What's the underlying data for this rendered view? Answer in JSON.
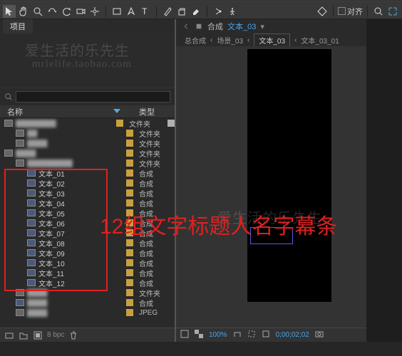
{
  "toolbar": {
    "align_label": "对齐"
  },
  "panel": {
    "project_tab": "项目"
  },
  "columns": {
    "name": "名称",
    "type_header": "类型"
  },
  "types": {
    "folder": "文件夹",
    "comp": "合成",
    "jpeg": "JPEG"
  },
  "tree": {
    "top_rows": [
      {
        "label": "████████",
        "type": "folder",
        "blur": true,
        "indent": 0,
        "shelf": true
      },
      {
        "label": "██",
        "type": "folder",
        "blur": true,
        "indent": 1
      },
      {
        "label": "████",
        "type": "folder",
        "blur": true,
        "indent": 1
      },
      {
        "label": "████",
        "type": "folder",
        "blur": true,
        "indent": 0
      },
      {
        "label": "█████████",
        "type": "folder",
        "blur": true,
        "indent": 1
      }
    ],
    "comp_items": [
      {
        "label": "文本_01",
        "type": "comp",
        "indent": 2
      },
      {
        "label": "文本_02",
        "type": "comp",
        "indent": 2
      },
      {
        "label": "文本_03",
        "type": "comp",
        "indent": 2
      },
      {
        "label": "文本_04",
        "type": "comp",
        "indent": 2
      },
      {
        "label": "文本_05",
        "type": "comp",
        "indent": 2
      },
      {
        "label": "文本_06",
        "type": "comp",
        "indent": 2
      },
      {
        "label": "文本_07",
        "type": "comp",
        "indent": 2
      },
      {
        "label": "文本_08",
        "type": "comp",
        "indent": 2
      },
      {
        "label": "文本_09",
        "type": "comp",
        "indent": 2
      },
      {
        "label": "文本_10",
        "type": "comp",
        "indent": 2
      },
      {
        "label": "文本_11",
        "type": "comp",
        "indent": 2
      },
      {
        "label": "文本_12",
        "type": "comp",
        "indent": 2
      }
    ],
    "bottom_rows": [
      {
        "label": "████",
        "type": "folder",
        "blur": true,
        "indent": 1
      },
      {
        "label": "████",
        "type": "comp",
        "blur": true,
        "indent": 1
      },
      {
        "label": "████",
        "type": "jpeg",
        "blur": true,
        "indent": 1
      }
    ]
  },
  "status": {
    "bpc": "8 bpc"
  },
  "viewer": {
    "tab_type": "合成",
    "tab_name": "文本_03",
    "crumb1": "总合成",
    "crumb2": "场景_03",
    "crumb3": "文本_03",
    "crumb4": "文本_03_01",
    "zoom": "100%",
    "time": "0;00;02;02"
  },
  "overlay": {
    "red_text": "12组文字标题人名字幕条",
    "wm1": "爱生活的乐先生",
    "wm2": "mrlelife.taobao.com",
    "wm3": "爱生活的乐先生"
  }
}
